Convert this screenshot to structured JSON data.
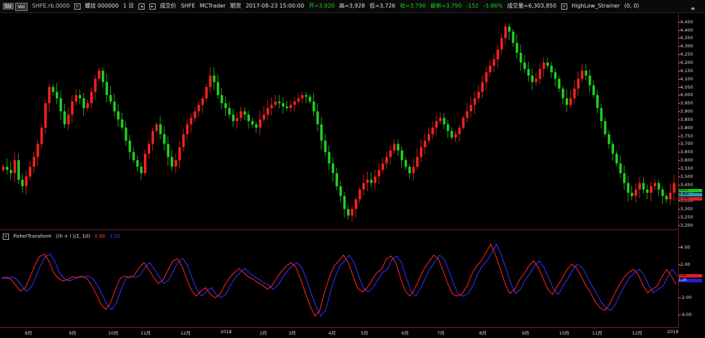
{
  "toolbar": {
    "badge": "SU",
    "badge2": "Vol",
    "symbol_box": "SHFE.rb.0000",
    "label_code": "螺纹 000000",
    "interval": "1 日",
    "left_arrow": "◂",
    "right_arrow": "▸",
    "type_label": "成交价",
    "exchange": "SHFE",
    "source": "MCTrader",
    "period_label": "期货",
    "datetime": "2017-08-23 15:00:00",
    "open": "开=3,920",
    "high": "高=3,928",
    "low": "低=3,726",
    "close": "收=3,790",
    "last": "最新=3,790",
    "change": "-152",
    "change_pct": "-3.86%",
    "volume": "成交量=6,303,850",
    "indicator": "HighLow_Strainer",
    "indicator_params": "(0, 0)"
  },
  "sub_title": {
    "name": "FisherTransform",
    "params": "((h + l )/2,  10)",
    "val1": "0.86",
    "val2": "1.20"
  },
  "menu_icon": "≡",
  "y_axis_main": [
    "4,450",
    "4,400",
    "4,350",
    "4,300",
    "4,250",
    "4,200",
    "4,150",
    "4,100",
    "4,050",
    "4,000",
    "3,950",
    "3,900",
    "3,850",
    "3,800",
    "3,750",
    "3,700",
    "3,650",
    "3,600",
    "3,550",
    "3,500",
    "3,450",
    "3,400",
    "3,350",
    "3,300",
    "3,250",
    "3,200"
  ],
  "y_axis_sub": [
    "4.00",
    "2.00",
    "0.00",
    "-2.00",
    "-4.00"
  ],
  "price_tags": [
    "3,415",
    "3,395",
    "3,390"
  ],
  "sub_tags": [
    "0.86",
    "1.20"
  ],
  "x_axis": [
    "8月",
    "9月",
    "10月",
    "11月",
    "12月",
    "2018",
    "2月",
    "3月",
    "4月",
    "5月",
    "6月",
    "7月",
    "8月",
    "9月",
    "10月",
    "11月",
    "12月",
    "2019"
  ],
  "colors": {
    "up": "#ff2020",
    "down": "#20d020",
    "fisher": "#ff2020",
    "trigger": "#3030ff",
    "grid": "#7a1f1f"
  },
  "chart_data": {
    "type": "candlestick",
    "symbol": "SHFE.rb.0000",
    "price_range": [
      3200,
      4470
    ],
    "closes": [
      3560,
      3540,
      3520,
      3600,
      3480,
      3440,
      3500,
      3560,
      3620,
      3700,
      3800,
      3950,
      4050,
      4020,
      3980,
      3900,
      3820,
      3880,
      3960,
      4000,
      3980,
      3920,
      3950,
      4020,
      4100,
      4150,
      4080,
      4000,
      3960,
      3900,
      3850,
      3800,
      3720,
      3650,
      3600,
      3560,
      3520,
      3640,
      3700,
      3780,
      3820,
      3760,
      3700,
      3620,
      3560,
      3600,
      3680,
      3760,
      3820,
      3860,
      3900,
      3940,
      3980,
      4050,
      4120,
      4080,
      4000,
      3950,
      3920,
      3880,
      3840,
      3860,
      3900,
      3880,
      3840,
      3820,
      3800,
      3850,
      3880,
      3920,
      3940,
      3960,
      3950,
      3930,
      3920,
      3940,
      3960,
      3980,
      4000,
      3990,
      3960,
      3900,
      3820,
      3720,
      3650,
      3580,
      3520,
      3440,
      3380,
      3300,
      3260,
      3300,
      3360,
      3420,
      3460,
      3480,
      3460,
      3500,
      3540,
      3580,
      3620,
      3660,
      3700,
      3660,
      3600,
      3560,
      3520,
      3560,
      3620,
      3680,
      3720,
      3760,
      3800,
      3840,
      3860,
      3820,
      3780,
      3740,
      3760,
      3800,
      3860,
      3900,
      3940,
      3980,
      4020,
      4080,
      4140,
      4180,
      4220,
      4280,
      4350,
      4420,
      4390,
      4320,
      4260,
      4200,
      4160,
      4120,
      4080,
      4100,
      4160,
      4200,
      4180,
      4140,
      4100,
      4040,
      3980,
      3940,
      3980,
      4040,
      4100,
      4150,
      4120,
      4060,
      4000,
      3920,
      3840,
      3760,
      3700,
      3640,
      3580,
      3520,
      3460,
      3400,
      3380,
      3420,
      3460,
      3420,
      3400,
      3440,
      3460,
      3420,
      3380,
      3360,
      3400,
      3460
    ],
    "fisher": [
      0.3,
      0.5,
      0.2,
      -0.5,
      -1.2,
      -0.8,
      0.4,
      1.8,
      2.9,
      3.2,
      2.4,
      1.0,
      0.3,
      0.0,
      0.2,
      0.5,
      0.4,
      0.6,
      0.3,
      -0.5,
      -1.6,
      -2.8,
      -3.4,
      -2.6,
      -1.0,
      0.3,
      0.6,
      0.4,
      0.7,
      1.6,
      2.2,
      1.4,
      0.5,
      -0.3,
      0.1,
      1.2,
      2.3,
      2.7,
      1.8,
      0.2,
      -1.1,
      -1.8,
      -1.2,
      -0.8,
      -1.6,
      -2.0,
      -1.6,
      -0.5,
      0.4,
      1.0,
      1.5,
      1.0,
      0.5,
      0.2,
      -0.2,
      -0.5,
      -1.0,
      -0.5,
      0.4,
      1.2,
      1.8,
      2.2,
      1.6,
      0.2,
      -1.5,
      -3.0,
      -4.2,
      -3.5,
      -1.4,
      0.4,
      1.8,
      2.4,
      3.1,
      2.2,
      0.6,
      -0.9,
      -1.3,
      -0.8,
      0.1,
      1.0,
      1.4,
      2.6,
      3.0,
      2.2,
      0.4,
      -1.2,
      -1.8,
      -0.9,
      0.3,
      1.5,
      2.3,
      3.1,
      2.6,
      1.2,
      -0.4,
      -1.6,
      -1.8,
      -1.5,
      -0.6,
      0.8,
      1.8,
      2.4,
      3.4,
      4.4,
      3.1,
      1.5,
      -0.3,
      -1.5,
      -1.0,
      0.1,
      0.9,
      1.8,
      2.4,
      1.6,
      0.3,
      -1.0,
      -1.6,
      -0.6,
      0.3,
      1.3,
      2.0,
      1.6,
      0.6,
      -0.5,
      -1.4,
      -2.5,
      -3.2,
      -3.5,
      -2.8,
      -1.6,
      -0.5,
      0.4,
      1.0,
      1.4,
      0.8,
      -0.5,
      -1.4,
      -1.0,
      -0.6,
      0.5,
      1.4,
      0.6,
      -0.4
    ]
  }
}
